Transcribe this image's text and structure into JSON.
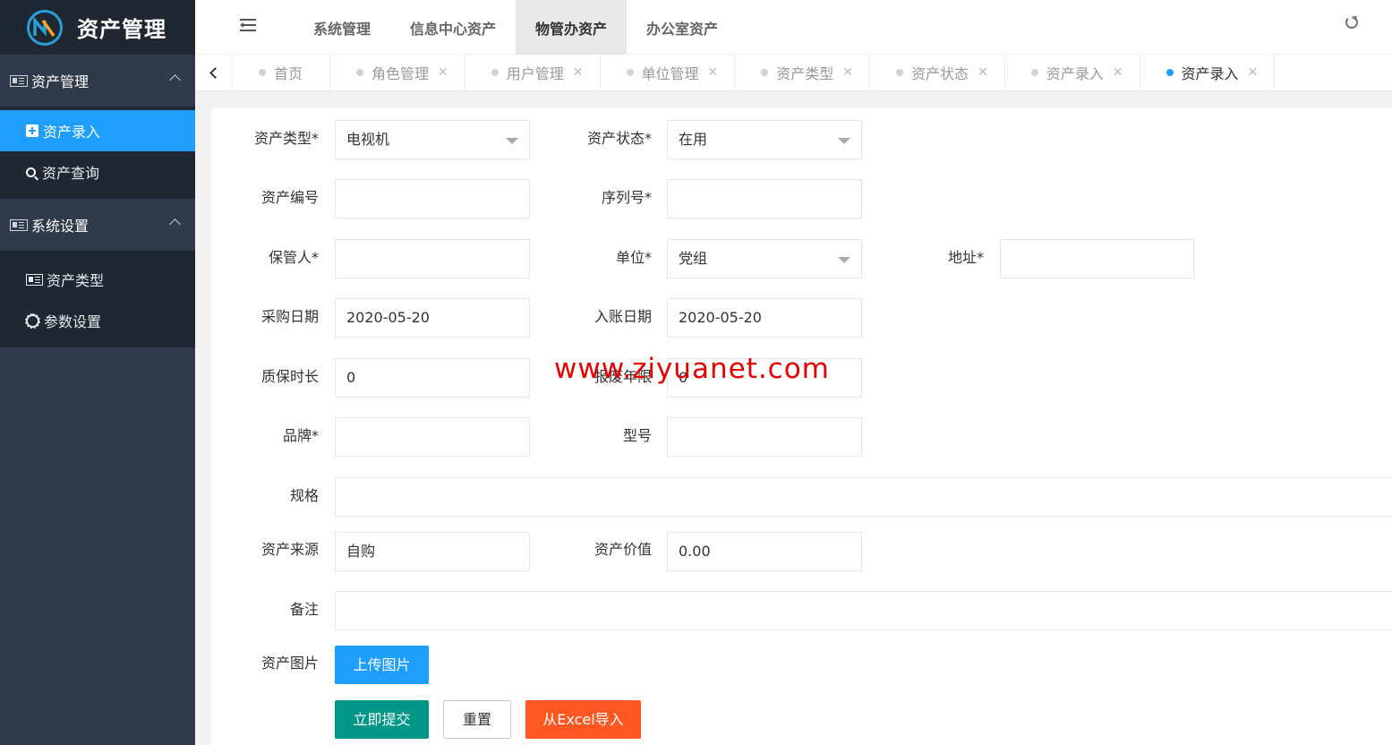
{
  "app": {
    "title": "资产管理"
  },
  "sidebar": {
    "groups": [
      {
        "label": "资产管理",
        "items": [
          {
            "label": "资产录入"
          },
          {
            "label": "资产查询"
          }
        ]
      },
      {
        "label": "系统设置",
        "items": [
          {
            "label": "资产类型"
          },
          {
            "label": "参数设置"
          }
        ]
      }
    ]
  },
  "topnav": {
    "items": [
      {
        "label": "系统管理"
      },
      {
        "label": "信息中心资产"
      },
      {
        "label": "物管办资产"
      },
      {
        "label": "办公室资产"
      }
    ],
    "active_index": 2
  },
  "tabs": [
    {
      "label": "首页"
    },
    {
      "label": "角色管理"
    },
    {
      "label": "用户管理"
    },
    {
      "label": "单位管理"
    },
    {
      "label": "资产类型"
    },
    {
      "label": "资产状态"
    },
    {
      "label": "资产录入"
    },
    {
      "label": "资产录入"
    }
  ],
  "form": {
    "asset_type": {
      "label": "资产类型*",
      "value": "电视机"
    },
    "asset_status": {
      "label": "资产状态*",
      "value": "在用"
    },
    "asset_no": {
      "label": "资产编号",
      "value": ""
    },
    "serial_no": {
      "label": "序列号*",
      "value": ""
    },
    "keeper": {
      "label": "保管人*",
      "value": ""
    },
    "unit": {
      "label": "单位*",
      "value": "党组"
    },
    "address": {
      "label": "地址*",
      "value": ""
    },
    "purchase_date": {
      "label": "采购日期",
      "value": "2020-05-20"
    },
    "entry_date": {
      "label": "入账日期",
      "value": "2020-05-20"
    },
    "warranty": {
      "label": "质保时长",
      "value": "0"
    },
    "scrap_years": {
      "label": "报废年限",
      "value": "0"
    },
    "brand": {
      "label": "品牌*",
      "value": ""
    },
    "model": {
      "label": "型号",
      "value": ""
    },
    "spec": {
      "label": "规格",
      "value": ""
    },
    "source": {
      "label": "资产来源",
      "value": "自购"
    },
    "price": {
      "label": "资产价值",
      "value": "0.00"
    },
    "remark": {
      "label": "备注",
      "value": ""
    },
    "image": {
      "label": "资产图片"
    }
  },
  "buttons": {
    "upload": "上传图片",
    "submit": "立即提交",
    "reset": "重置",
    "import": "从Excel导入"
  },
  "watermark": "www.ziyuanet.com",
  "colors": {
    "primary": "#1e9fff",
    "green": "#009688",
    "orange": "#ff5722",
    "sidebar": "#2f3a4a"
  }
}
